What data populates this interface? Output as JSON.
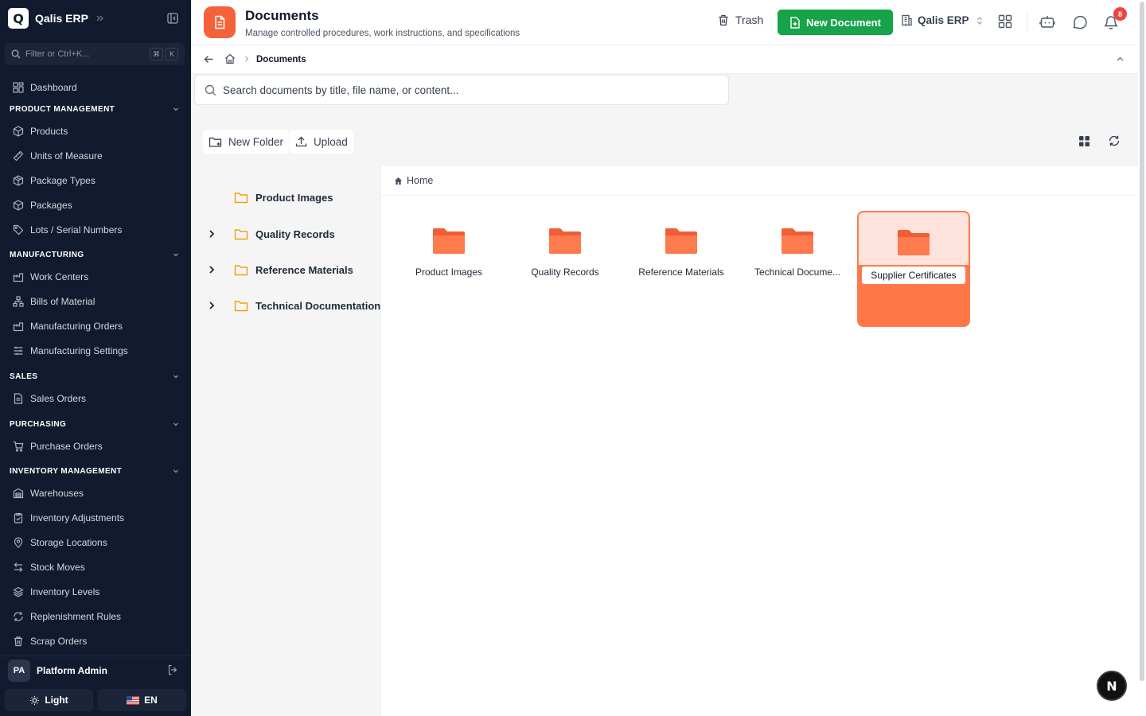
{
  "sidebar": {
    "brand_letter": "Q",
    "brand_name": "Qalis ERP",
    "filter_placeholder": "Filter or Ctrl+K...",
    "filter_keys": [
      "⌘",
      "K"
    ],
    "dashboard": "Dashboard",
    "sections": [
      {
        "title": "PRODUCT MANAGEMENT",
        "items": [
          "Products",
          "Units of Measure",
          "Package Types",
          "Packages",
          "Lots / Serial Numbers"
        ]
      },
      {
        "title": "MANUFACTURING",
        "items": [
          "Work Centers",
          "Bills of Material",
          "Manufacturing Orders",
          "Manufacturing Settings"
        ]
      },
      {
        "title": "SALES",
        "items": [
          "Sales Orders"
        ]
      },
      {
        "title": "PURCHASING",
        "items": [
          "Purchase Orders"
        ]
      },
      {
        "title": "INVENTORY MANAGEMENT",
        "items": [
          "Warehouses",
          "Inventory Adjustments",
          "Storage Locations",
          "Stock Moves",
          "Inventory Levels",
          "Replenishment Rules",
          "Scrap Orders"
        ]
      }
    ],
    "user": {
      "initials": "PA",
      "name": "Platform Admin"
    },
    "theme_label": "Light",
    "lang_label": "EN"
  },
  "header": {
    "title": "Documents",
    "subtitle": "Manage controlled procedures, work instructions, and specifications",
    "trash_label": "Trash",
    "new_document_label": "New Document",
    "org_label": "Qalis ERP",
    "notification_count": "8"
  },
  "breadcrumb": {
    "current": "Documents"
  },
  "search": {
    "placeholder": "Search documents by title, file name, or content..."
  },
  "toolbar": {
    "new_folder_label": "New Folder",
    "upload_label": "Upload"
  },
  "tree": [
    {
      "label": "Product Images",
      "expandable": false
    },
    {
      "label": "Quality Records",
      "expandable": true
    },
    {
      "label": "Reference Materials",
      "expandable": true
    },
    {
      "label": "Technical Documentation",
      "expandable": true
    }
  ],
  "main": {
    "crumb_home": "Home",
    "folders": [
      "Product Images",
      "Quality Records",
      "Reference Materials",
      "Technical Docume..."
    ],
    "renaming_value": "Supplier Certificates"
  },
  "fab_label": "N",
  "colors": {
    "accent": "#f4623a",
    "primary_action": "#16a34a",
    "sidebar_bg": "#111a2e",
    "folder_tree": "#f59e0b"
  }
}
